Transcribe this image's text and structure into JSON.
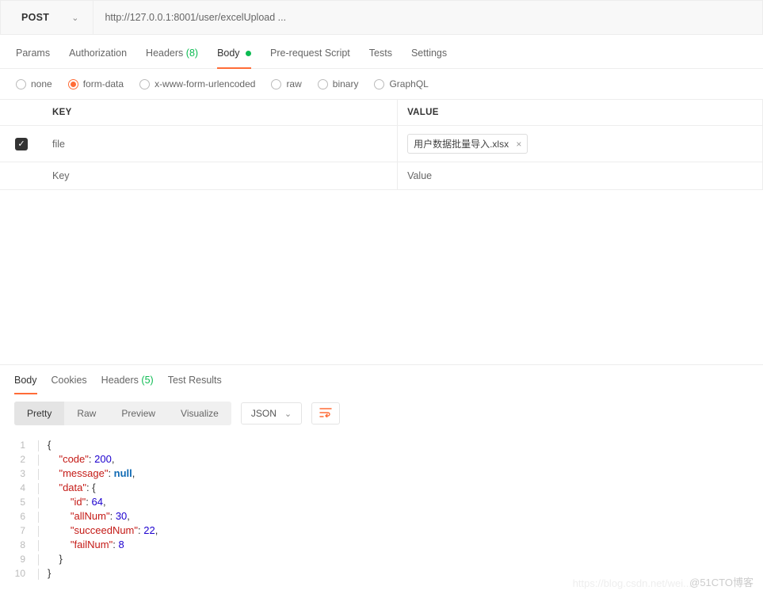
{
  "request": {
    "method": "POST",
    "url": "http://127.0.0.1:8001/user/excelUpload ..."
  },
  "requestTabs": {
    "params": "Params",
    "authorization": "Authorization",
    "headers": "Headers",
    "headersCount": "(8)",
    "body": "Body",
    "preRequest": "Pre-request Script",
    "tests": "Tests",
    "settings": "Settings"
  },
  "bodyTypes": {
    "none": "none",
    "formData": "form-data",
    "urlencoded": "x-www-form-urlencoded",
    "raw": "raw",
    "binary": "binary",
    "graphql": "GraphQL"
  },
  "formTable": {
    "keyHeader": "KEY",
    "valueHeader": "VALUE",
    "row1": {
      "key": "file",
      "fileName": "用户数据批量导入.xlsx"
    },
    "placeholder": {
      "key": "Key",
      "value": "Value"
    }
  },
  "responseTabs": {
    "body": "Body",
    "cookies": "Cookies",
    "headers": "Headers",
    "headersCount": "(5)",
    "testResults": "Test Results"
  },
  "viewBar": {
    "pretty": "Pretty",
    "raw": "Raw",
    "preview": "Preview",
    "visualize": "Visualize",
    "format": "JSON"
  },
  "response": {
    "l1": "{",
    "l2a": "\"code\"",
    "l2b": ": ",
    "l2c": "200",
    "l2d": ",",
    "l3a": "\"message\"",
    "l3b": ": ",
    "l3c": "null",
    "l3d": ",",
    "l4a": "\"data\"",
    "l4b": ": {",
    "l5a": "\"id\"",
    "l5b": ": ",
    "l5c": "64",
    "l5d": ",",
    "l6a": "\"allNum\"",
    "l6b": ": ",
    "l6c": "30",
    "l6d": ",",
    "l7a": "\"succeedNum\"",
    "l7b": ": ",
    "l7c": "22",
    "l7d": ",",
    "l8a": "\"failNum\"",
    "l8b": ": ",
    "l8c": "8",
    "l9": "}",
    "l10": "}"
  },
  "watermark": "@51CTO博客",
  "watermark2": "https://blog.csdn.net/wei..."
}
